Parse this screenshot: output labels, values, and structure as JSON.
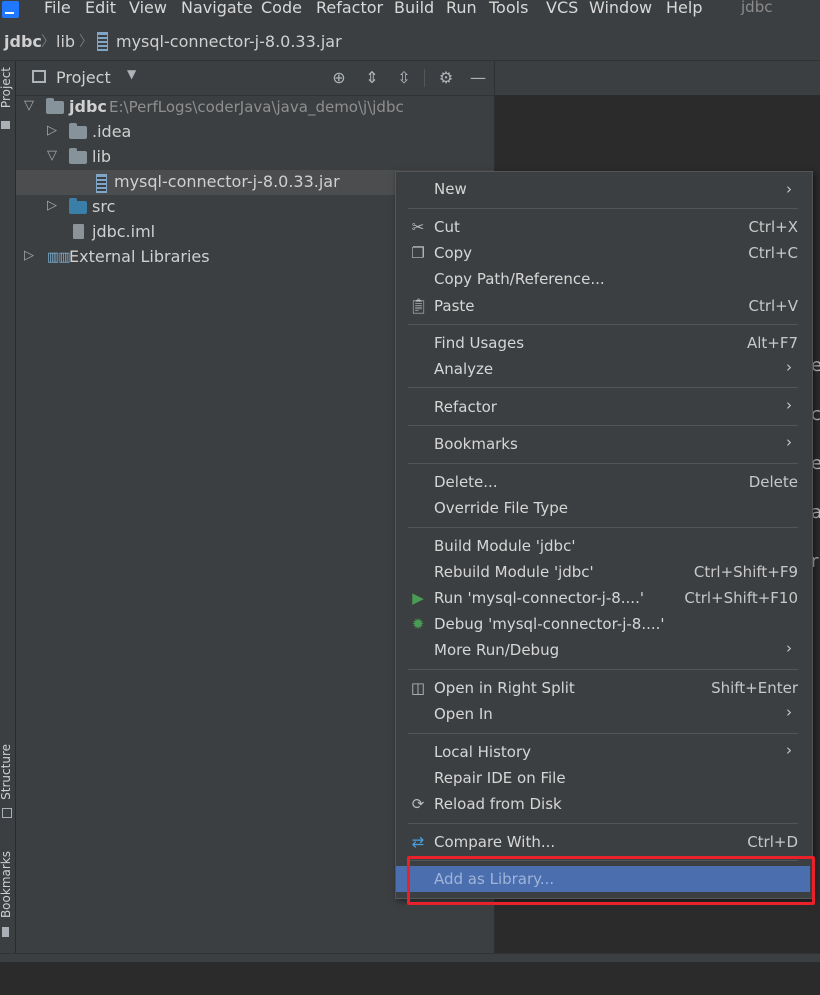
{
  "app_title": "jdbc",
  "menu": [
    "File",
    "Edit",
    "View",
    "Navigate",
    "Code",
    "Refactor",
    "Build",
    "Run",
    "Tools",
    "VCS",
    "Window",
    "Help"
  ],
  "breadcrumb": [
    "jdbc",
    "lib",
    "mysql-connector-j-8.0.33.jar"
  ],
  "tool_tabs": {
    "project": "Project",
    "structure": "Structure",
    "bookmarks": "Bookmarks"
  },
  "panel": {
    "title": "Project"
  },
  "tree": [
    {
      "label": "jdbc",
      "path": "E:\\PerfLogs\\coderJava\\java_demo\\j\\jdbc"
    },
    {
      "label": ".idea"
    },
    {
      "label": "lib"
    },
    {
      "label": "mysql-connector-j-8.0.33.jar"
    },
    {
      "label": "src"
    },
    {
      "label": "jdbc.iml"
    },
    {
      "label": "External Libraries"
    }
  ],
  "editor_peek": [
    "e",
    "c",
    "e",
    "a",
    "r"
  ],
  "context_menu": [
    {
      "label": "New",
      "shortcut": "",
      "submenu": true
    },
    {
      "label": "Cut",
      "shortcut": "Ctrl+X",
      "icon": "scissors-icon"
    },
    {
      "label": "Copy",
      "shortcut": "Ctrl+C",
      "icon": "copy-icon"
    },
    {
      "label": "Copy Path/Reference...",
      "shortcut": ""
    },
    {
      "label": "Paste",
      "shortcut": "Ctrl+V",
      "icon": "clipboard-icon"
    },
    {
      "label": "Find Usages",
      "shortcut": "Alt+F7"
    },
    {
      "label": "Analyze",
      "shortcut": "",
      "submenu": true
    },
    {
      "label": "Refactor",
      "shortcut": "",
      "submenu": true
    },
    {
      "label": "Bookmarks",
      "shortcut": "",
      "submenu": true
    },
    {
      "label": "Delete...",
      "shortcut": "Delete"
    },
    {
      "label": "Override File Type",
      "shortcut": ""
    },
    {
      "label": "Build Module 'jdbc'",
      "shortcut": ""
    },
    {
      "label": "Rebuild Module 'jdbc'",
      "shortcut": "Ctrl+Shift+F9"
    },
    {
      "label": "Run 'mysql-connector-j-8....'",
      "shortcut": "Ctrl+Shift+F10",
      "icon": "run-icon"
    },
    {
      "label": "Debug 'mysql-connector-j-8....'",
      "shortcut": "",
      "icon": "debug-icon"
    },
    {
      "label": "More Run/Debug",
      "shortcut": "",
      "submenu": true
    },
    {
      "label": "Open in Right Split",
      "shortcut": "Shift+Enter",
      "icon": "split-icon"
    },
    {
      "label": "Open In",
      "shortcut": "",
      "submenu": true
    },
    {
      "label": "Local History",
      "shortcut": "",
      "submenu": true
    },
    {
      "label": "Repair IDE on File",
      "shortcut": ""
    },
    {
      "label": "Reload from Disk",
      "shortcut": "",
      "icon": "reload-icon"
    },
    {
      "label": "Compare With...",
      "shortcut": "Ctrl+D",
      "icon": "compare-icon"
    },
    {
      "label": "Add as Library...",
      "shortcut": "",
      "highlighted": true
    }
  ],
  "colors": {
    "highlight": "#4b6eaf",
    "annotation_box": "#e8212b",
    "run_green": "#499c54"
  }
}
